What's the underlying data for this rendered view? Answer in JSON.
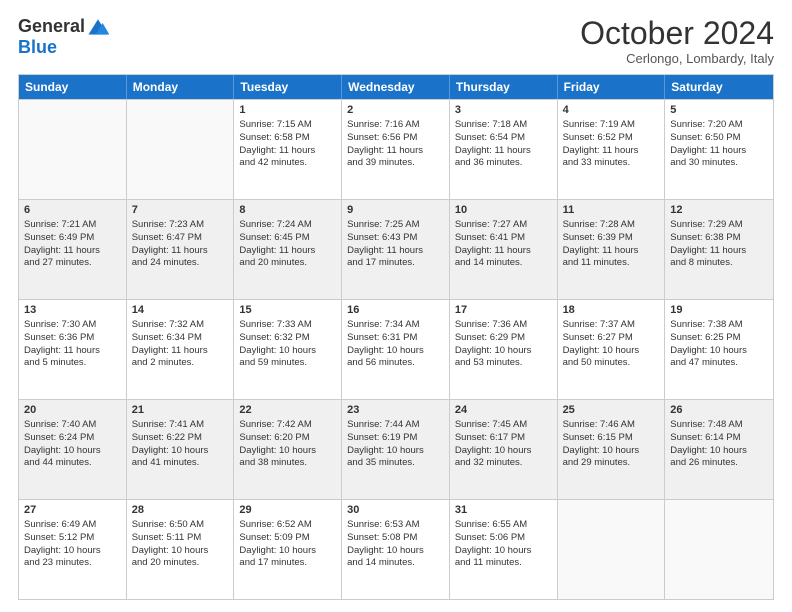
{
  "header": {
    "logo_line1": "General",
    "logo_line2": "Blue",
    "month": "October 2024",
    "location": "Cerlongo, Lombardy, Italy"
  },
  "weekdays": [
    "Sunday",
    "Monday",
    "Tuesday",
    "Wednesday",
    "Thursday",
    "Friday",
    "Saturday"
  ],
  "rows": [
    [
      {
        "day": "",
        "empty": true
      },
      {
        "day": "",
        "empty": true
      },
      {
        "day": "1",
        "line1": "Sunrise: 7:15 AM",
        "line2": "Sunset: 6:58 PM",
        "line3": "Daylight: 11 hours",
        "line4": "and 42 minutes."
      },
      {
        "day": "2",
        "line1": "Sunrise: 7:16 AM",
        "line2": "Sunset: 6:56 PM",
        "line3": "Daylight: 11 hours",
        "line4": "and 39 minutes."
      },
      {
        "day": "3",
        "line1": "Sunrise: 7:18 AM",
        "line2": "Sunset: 6:54 PM",
        "line3": "Daylight: 11 hours",
        "line4": "and 36 minutes."
      },
      {
        "day": "4",
        "line1": "Sunrise: 7:19 AM",
        "line2": "Sunset: 6:52 PM",
        "line3": "Daylight: 11 hours",
        "line4": "and 33 minutes."
      },
      {
        "day": "5",
        "line1": "Sunrise: 7:20 AM",
        "line2": "Sunset: 6:50 PM",
        "line3": "Daylight: 11 hours",
        "line4": "and 30 minutes."
      }
    ],
    [
      {
        "day": "6",
        "line1": "Sunrise: 7:21 AM",
        "line2": "Sunset: 6:49 PM",
        "line3": "Daylight: 11 hours",
        "line4": "and 27 minutes.",
        "shaded": true
      },
      {
        "day": "7",
        "line1": "Sunrise: 7:23 AM",
        "line2": "Sunset: 6:47 PM",
        "line3": "Daylight: 11 hours",
        "line4": "and 24 minutes.",
        "shaded": true
      },
      {
        "day": "8",
        "line1": "Sunrise: 7:24 AM",
        "line2": "Sunset: 6:45 PM",
        "line3": "Daylight: 11 hours",
        "line4": "and 20 minutes.",
        "shaded": true
      },
      {
        "day": "9",
        "line1": "Sunrise: 7:25 AM",
        "line2": "Sunset: 6:43 PM",
        "line3": "Daylight: 11 hours",
        "line4": "and 17 minutes.",
        "shaded": true
      },
      {
        "day": "10",
        "line1": "Sunrise: 7:27 AM",
        "line2": "Sunset: 6:41 PM",
        "line3": "Daylight: 11 hours",
        "line4": "and 14 minutes.",
        "shaded": true
      },
      {
        "day": "11",
        "line1": "Sunrise: 7:28 AM",
        "line2": "Sunset: 6:39 PM",
        "line3": "Daylight: 11 hours",
        "line4": "and 11 minutes.",
        "shaded": true
      },
      {
        "day": "12",
        "line1": "Sunrise: 7:29 AM",
        "line2": "Sunset: 6:38 PM",
        "line3": "Daylight: 11 hours",
        "line4": "and 8 minutes.",
        "shaded": true
      }
    ],
    [
      {
        "day": "13",
        "line1": "Sunrise: 7:30 AM",
        "line2": "Sunset: 6:36 PM",
        "line3": "Daylight: 11 hours",
        "line4": "and 5 minutes."
      },
      {
        "day": "14",
        "line1": "Sunrise: 7:32 AM",
        "line2": "Sunset: 6:34 PM",
        "line3": "Daylight: 11 hours",
        "line4": "and 2 minutes."
      },
      {
        "day": "15",
        "line1": "Sunrise: 7:33 AM",
        "line2": "Sunset: 6:32 PM",
        "line3": "Daylight: 10 hours",
        "line4": "and 59 minutes."
      },
      {
        "day": "16",
        "line1": "Sunrise: 7:34 AM",
        "line2": "Sunset: 6:31 PM",
        "line3": "Daylight: 10 hours",
        "line4": "and 56 minutes."
      },
      {
        "day": "17",
        "line1": "Sunrise: 7:36 AM",
        "line2": "Sunset: 6:29 PM",
        "line3": "Daylight: 10 hours",
        "line4": "and 53 minutes."
      },
      {
        "day": "18",
        "line1": "Sunrise: 7:37 AM",
        "line2": "Sunset: 6:27 PM",
        "line3": "Daylight: 10 hours",
        "line4": "and 50 minutes."
      },
      {
        "day": "19",
        "line1": "Sunrise: 7:38 AM",
        "line2": "Sunset: 6:25 PM",
        "line3": "Daylight: 10 hours",
        "line4": "and 47 minutes."
      }
    ],
    [
      {
        "day": "20",
        "line1": "Sunrise: 7:40 AM",
        "line2": "Sunset: 6:24 PM",
        "line3": "Daylight: 10 hours",
        "line4": "and 44 minutes.",
        "shaded": true
      },
      {
        "day": "21",
        "line1": "Sunrise: 7:41 AM",
        "line2": "Sunset: 6:22 PM",
        "line3": "Daylight: 10 hours",
        "line4": "and 41 minutes.",
        "shaded": true
      },
      {
        "day": "22",
        "line1": "Sunrise: 7:42 AM",
        "line2": "Sunset: 6:20 PM",
        "line3": "Daylight: 10 hours",
        "line4": "and 38 minutes.",
        "shaded": true
      },
      {
        "day": "23",
        "line1": "Sunrise: 7:44 AM",
        "line2": "Sunset: 6:19 PM",
        "line3": "Daylight: 10 hours",
        "line4": "and 35 minutes.",
        "shaded": true
      },
      {
        "day": "24",
        "line1": "Sunrise: 7:45 AM",
        "line2": "Sunset: 6:17 PM",
        "line3": "Daylight: 10 hours",
        "line4": "and 32 minutes.",
        "shaded": true
      },
      {
        "day": "25",
        "line1": "Sunrise: 7:46 AM",
        "line2": "Sunset: 6:15 PM",
        "line3": "Daylight: 10 hours",
        "line4": "and 29 minutes.",
        "shaded": true
      },
      {
        "day": "26",
        "line1": "Sunrise: 7:48 AM",
        "line2": "Sunset: 6:14 PM",
        "line3": "Daylight: 10 hours",
        "line4": "and 26 minutes.",
        "shaded": true
      }
    ],
    [
      {
        "day": "27",
        "line1": "Sunrise: 6:49 AM",
        "line2": "Sunset: 5:12 PM",
        "line3": "Daylight: 10 hours",
        "line4": "and 23 minutes."
      },
      {
        "day": "28",
        "line1": "Sunrise: 6:50 AM",
        "line2": "Sunset: 5:11 PM",
        "line3": "Daylight: 10 hours",
        "line4": "and 20 minutes."
      },
      {
        "day": "29",
        "line1": "Sunrise: 6:52 AM",
        "line2": "Sunset: 5:09 PM",
        "line3": "Daylight: 10 hours",
        "line4": "and 17 minutes."
      },
      {
        "day": "30",
        "line1": "Sunrise: 6:53 AM",
        "line2": "Sunset: 5:08 PM",
        "line3": "Daylight: 10 hours",
        "line4": "and 14 minutes."
      },
      {
        "day": "31",
        "line1": "Sunrise: 6:55 AM",
        "line2": "Sunset: 5:06 PM",
        "line3": "Daylight: 10 hours",
        "line4": "and 11 minutes."
      },
      {
        "day": "",
        "empty": true
      },
      {
        "day": "",
        "empty": true
      }
    ]
  ]
}
